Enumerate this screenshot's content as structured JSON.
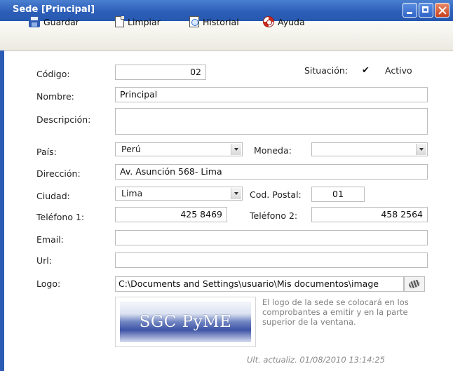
{
  "window": {
    "title": "Sede [Principal]"
  },
  "toolbar": {
    "save": "Guardar",
    "clear": "Limpiar",
    "history": "Historial",
    "help": "Ayuda"
  },
  "form": {
    "codigo": {
      "label": "Código:",
      "value": "02"
    },
    "situacion": {
      "label": "Situación:",
      "checked": true,
      "option": "Activo"
    },
    "nombre": {
      "label": "Nombre:",
      "value": "Principal"
    },
    "descripcion": {
      "label": "Descripción:",
      "value": ""
    },
    "pais": {
      "label": "País:",
      "value": "Perú"
    },
    "moneda": {
      "label": "Moneda:",
      "value": ""
    },
    "direccion": {
      "label": "Dirección:",
      "value": "Av. Asunción 568- Lima"
    },
    "ciudad": {
      "label": "Ciudad:",
      "value": "Lima"
    },
    "cod_postal": {
      "label": "Cod. Postal:",
      "value": "01"
    },
    "telefono1": {
      "label": "Teléfono 1:",
      "value": "425 8469"
    },
    "telefono2": {
      "label": "Teléfono 2:",
      "value": "458 2564"
    },
    "email": {
      "label": "Email:",
      "value": ""
    },
    "url": {
      "label": "Url:",
      "value": ""
    },
    "logo": {
      "label": "Logo:",
      "value": "C:\\Documents and Settings\\usuario\\Mis documentos\\image"
    },
    "logo_text": "SGC PyME",
    "hint": "El logo de la sede se colocará en los comprobantes a emitir y en la parte superior de la ventana."
  },
  "footer": {
    "updated": "Ult. actualiz.  01/08/2010   13:14:25"
  },
  "colors": {
    "titlebar": "#2d5fb8",
    "toolbar": "#ebe9e0",
    "hint": "#808080"
  }
}
